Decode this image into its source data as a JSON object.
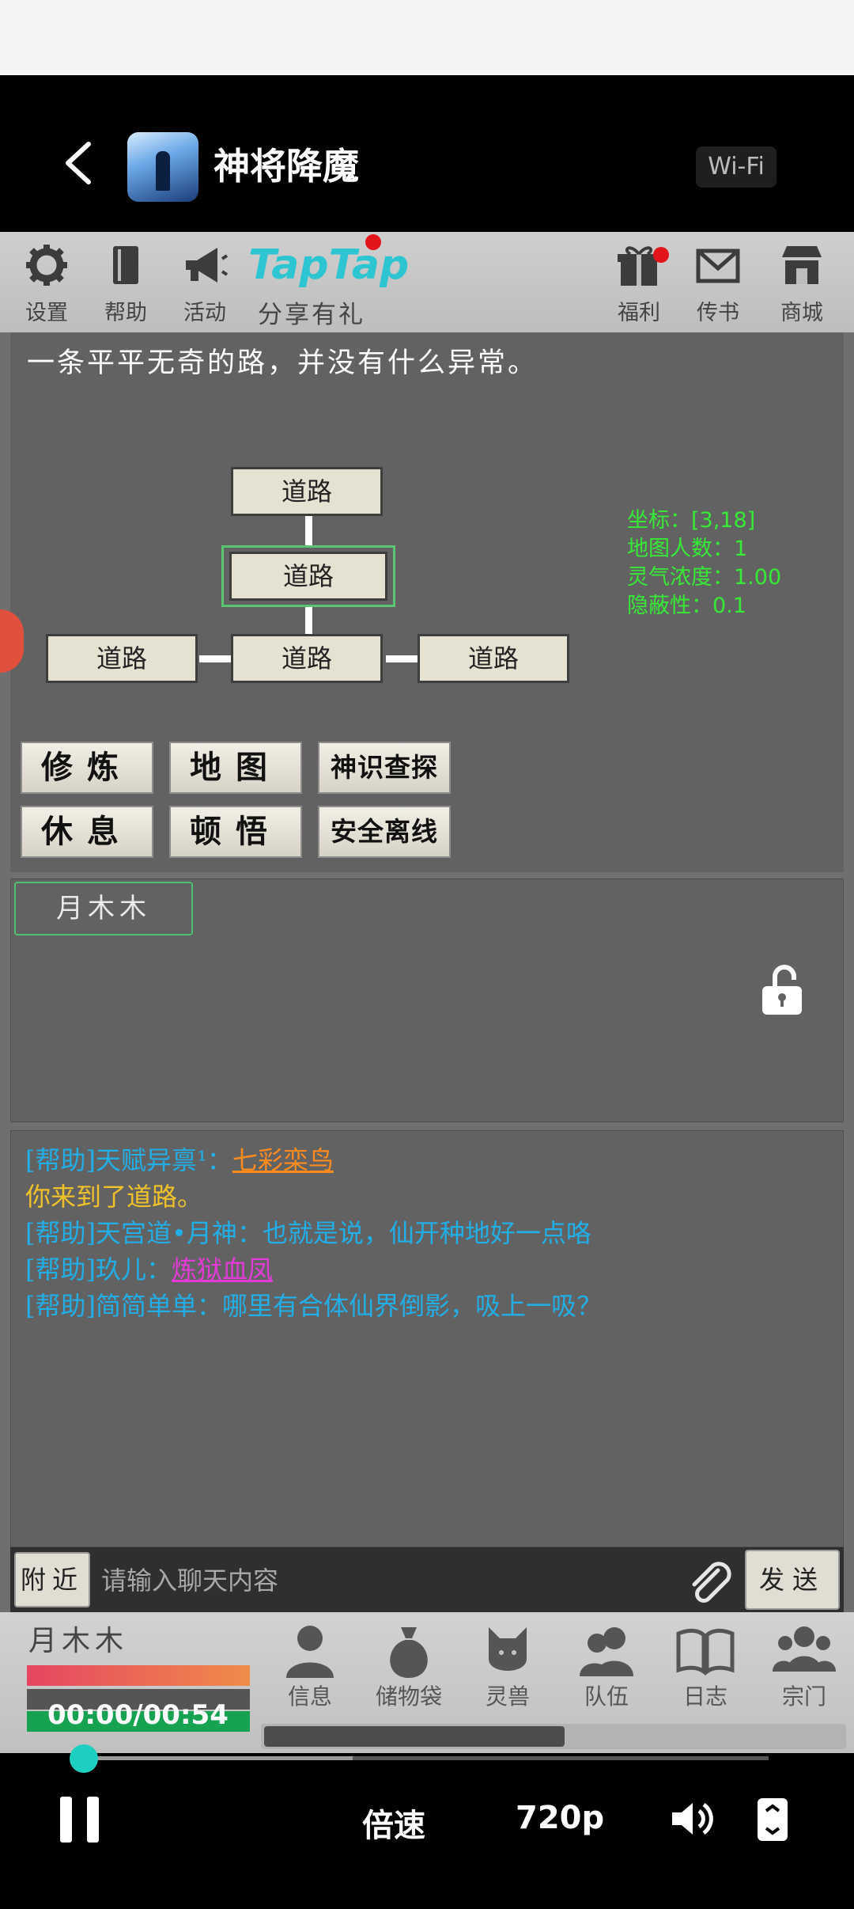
{
  "header": {
    "app_title": "神将降魔",
    "network_badge": "Wi-Fi",
    "back_icon": "chevron-left-icon"
  },
  "toolbar": {
    "settings": "设置",
    "help": "帮助",
    "events": "活动",
    "taptap_logo": "TapTap",
    "share": "分享有礼",
    "welfare": "福利",
    "mail": "传书",
    "shop": "商城"
  },
  "location": {
    "description": "一条平平无奇的路，并没有什么异常。",
    "map_nodes": [
      "道路",
      "道路",
      "道路",
      "道路",
      "道路"
    ],
    "stats": {
      "coords": "坐标：[3,18]",
      "players": "地图人数：1",
      "aura": "灵气浓度：1.00",
      "stealth": "隐蔽性：0.1"
    }
  },
  "actions": {
    "cultivate": "修炼",
    "map": "地图",
    "probe": "神识查探",
    "rest": "休息",
    "enlighten": "顿悟",
    "offline": "安全离线"
  },
  "player_tag": "月木木",
  "chat": {
    "line1_prefix": "[帮助]天赋异禀¹：",
    "line1_link": "七彩栾鸟",
    "line2": "你来到了道路。",
    "line3": "[帮助]天宫道•月神：也就是说，仙开种地好一点咯",
    "line4_prefix": "[帮助]玖儿：",
    "line4_link": "炼狱血凤",
    "line5": "[帮助]简简单单：哪里有合体仙界倒影，吸上一吸？"
  },
  "input": {
    "nearby_button": "附近",
    "placeholder": "请输入聊天内容",
    "send_button": "发送"
  },
  "bottom": {
    "player_name": "月木木",
    "bars": {
      "hp": 1.0,
      "mp": 0.0,
      "exp": 1.0
    },
    "nav": [
      "信息",
      "储物袋",
      "灵兽",
      "队伍",
      "日志",
      "宗门"
    ]
  },
  "player": {
    "time": "00:00/00:54",
    "speed": "倍速",
    "quality": "720p",
    "progress": 0.0
  },
  "colors": {
    "accent": "#1ccfc0",
    "chat_blue": "#22aee6",
    "chat_yellow": "#f0c22a",
    "stats_green": "#36ea36",
    "notify_red": "#e3151a"
  }
}
